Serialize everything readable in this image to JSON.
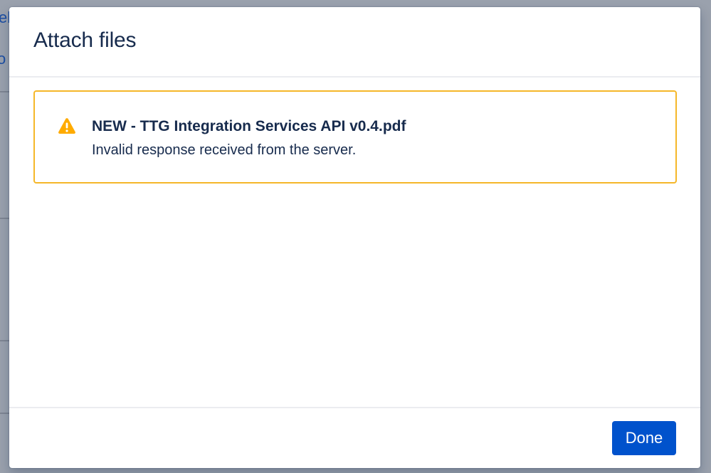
{
  "background": {
    "fragment_top": "eb",
    "fragment_mid": "o"
  },
  "dialog": {
    "title": "Attach files",
    "warning": {
      "icon": "warning-triangle-icon",
      "filename": "NEW - TTG Integration Services API v0.4.pdf",
      "message": "Invalid response received from the server."
    },
    "footer": {
      "done_label": "Done"
    }
  },
  "colors": {
    "accent": "#0052cc",
    "warning": "#ffab00",
    "warning_border": "#f5b729",
    "text": "#172b4d"
  }
}
